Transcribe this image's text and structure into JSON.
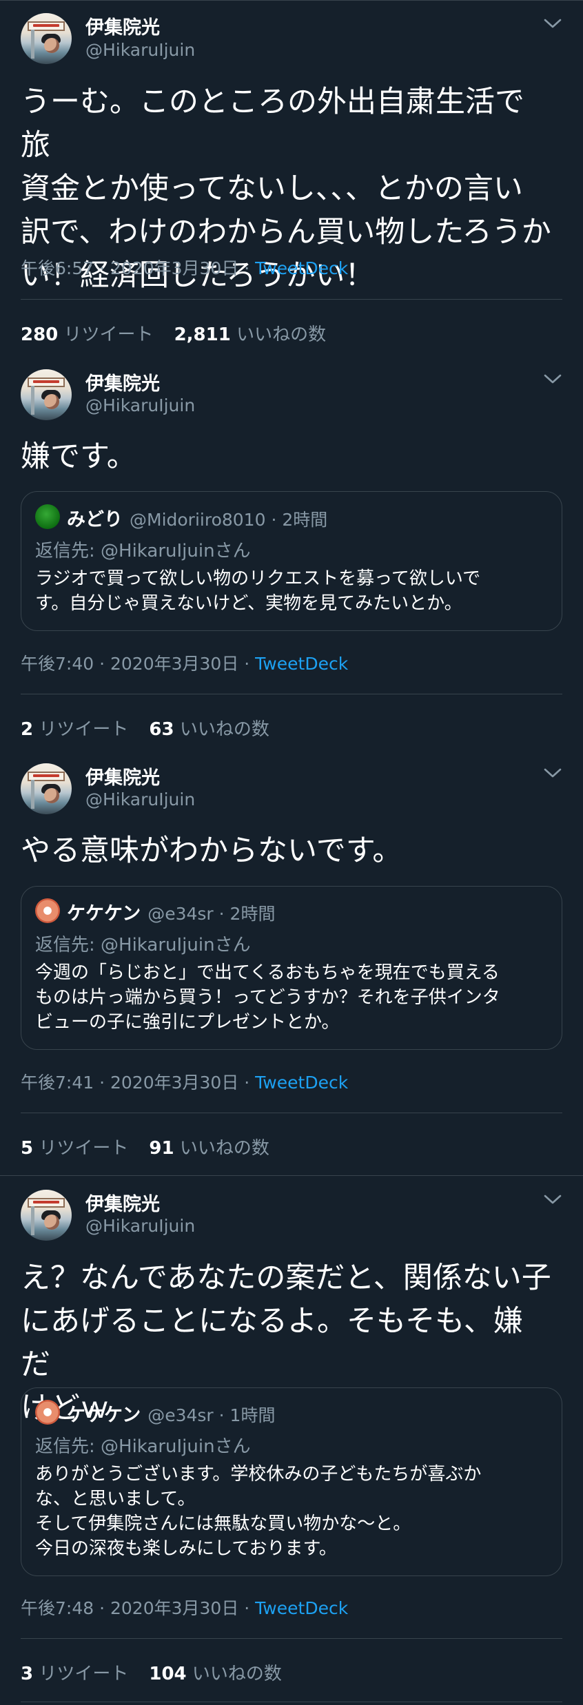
{
  "tweets": [
    {
      "name": "伊集院光",
      "handle": "@HikaruIjuin",
      "text": "うーむ。このところの外出自粛生活で旅\n資金とか使ってないし、、、とかの言い\n訳で、わけのわからん買い物したろうか\nい！経済回したろうかい！",
      "time": "午後6:57 · 2020年3月30日 · ",
      "client": "TweetDeck",
      "retweets": "280",
      "retweets_label": "リツイート",
      "likes": "2,811",
      "likes_label": "いいねの数"
    },
    {
      "name": "伊集院光",
      "handle": "@HikaruIjuin",
      "text": "嫌です。",
      "quote": {
        "name": "みどり",
        "handle": "@Midoriiro8010 · 2時間",
        "reply": "返信先: @HikaruIjuinさん",
        "text": "ラジオで買って欲しい物のリクエストを募って欲しいで\nす。自分じゃ買えないけど、実物を見てみたいとか。"
      },
      "time": "午後7:40 · 2020年3月30日 · ",
      "client": "TweetDeck",
      "retweets": "2",
      "retweets_label": "リツイート",
      "likes": "63",
      "likes_label": "いいねの数"
    },
    {
      "name": "伊集院光",
      "handle": "@HikaruIjuin",
      "text": "やる意味がわからないです。",
      "quote": {
        "name": "ケケケン",
        "handle": "@e34sr · 2時間",
        "reply": "返信先: @HikaruIjuinさん",
        "text": "今週の「らじおと」で出てくるおもちゃを現在でも買える\nものは片っ端から買う！ってどうすか？それを子供インタ\nビューの子に強引にプレゼントとか。"
      },
      "time": "午後7:41 · 2020年3月30日 · ",
      "client": "TweetDeck",
      "retweets": "5",
      "retweets_label": "リツイート",
      "likes": "91",
      "likes_label": "いいねの数"
    },
    {
      "name": "伊集院光",
      "handle": "@HikaruIjuin",
      "text": "え？なんであなたの案だと、関係ない子\nにあげることになるよ。そもそも、嫌だ\nけどｗ",
      "quote": {
        "name": "ケケケン",
        "handle": "@e34sr · 1時間",
        "reply": "返信先: @HikaruIjuinさん",
        "text": "ありがとうございます。学校休みの子どもたちが喜ぶか\nな、と思いまして。\nそして伊集院さんには無駄な買い物かな〜と。\n今日の深夜も楽しみにしております。"
      },
      "time": "午後7:48 · 2020年3月30日 · ",
      "client": "TweetDeck",
      "retweets": "3",
      "retweets_label": "リツイート",
      "likes": "104",
      "likes_label": "いいねの数"
    }
  ],
  "colors": {
    "background": "#15202b",
    "secondary_text": "#8899a6",
    "link": "#1da1f2",
    "border": "#38444d"
  }
}
